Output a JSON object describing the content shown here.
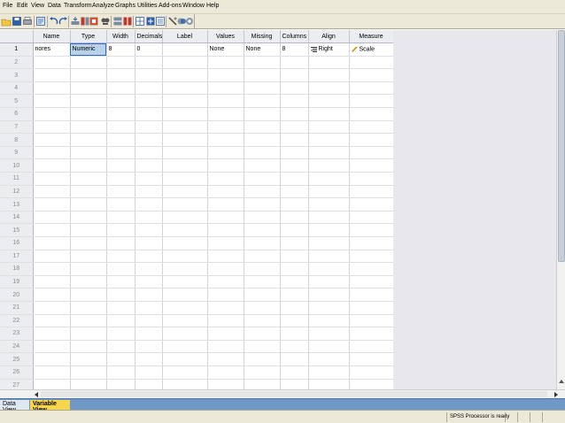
{
  "menubar": {
    "items": [
      "File",
      "Edit",
      "View",
      "Data",
      "Transform",
      "Analyze",
      "Graphs",
      "Utilities",
      "Add-ons",
      "Window",
      "Help"
    ]
  },
  "toolbar": {
    "icons": [
      "open-icon",
      "save-icon",
      "print-icon",
      "dialog-recall-icon",
      "undo-icon",
      "redo-icon",
      "goto-case-icon",
      "goto-variable-icon",
      "variables-icon",
      "find-icon",
      "insert-cases-icon",
      "insert-variable-icon",
      "split-file-icon",
      "weight-cases-icon",
      "select-cases-icon",
      "value-labels-icon",
      "use-sets-icon",
      "show-all-variables-icon"
    ]
  },
  "grid": {
    "columns": [
      "Name",
      "Type",
      "Width",
      "Decimals",
      "Label",
      "Values",
      "Missing",
      "Columns",
      "Align",
      "Measure"
    ],
    "row_numbers": [
      "1",
      "2",
      "3",
      "4",
      "5",
      "6",
      "7",
      "8",
      "9",
      "10",
      "11",
      "12",
      "13",
      "14",
      "15",
      "16",
      "17",
      "18",
      "19",
      "20",
      "21",
      "22",
      "23",
      "24",
      "25",
      "26",
      "27"
    ],
    "variable": {
      "name": "nores",
      "type": "Numeric",
      "width": "8",
      "decimals": "0",
      "label": "",
      "values": "None",
      "missing": "None",
      "columns": "8",
      "align": "Right",
      "measure": "Scale"
    }
  },
  "tabs": {
    "data_view": "Data View",
    "variable_view": "Variable View"
  },
  "status": {
    "processor": "SPSS  Processor is ready"
  },
  "colors": {
    "selected_cell": "#b9d1ea",
    "active_tab": "#f7d54b",
    "tab_bar": "#6f98c6"
  }
}
